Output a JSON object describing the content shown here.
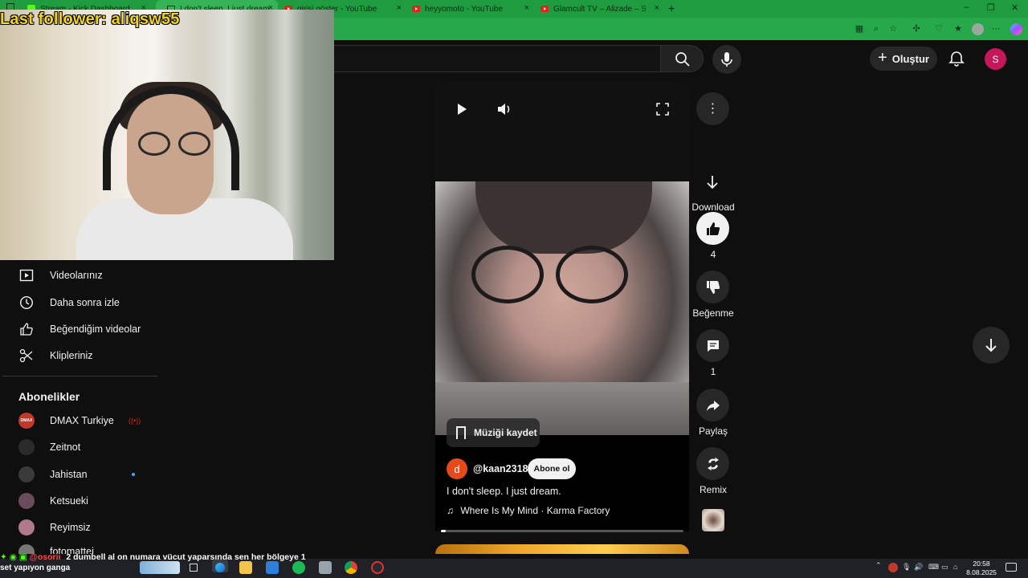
{
  "browser": {
    "tabs": [
      {
        "title": "Stream - Kick Dashboard"
      },
      {
        "title": "I don't sleep. I just dream."
      },
      {
        "title": "girişi göster - YouTube"
      },
      {
        "title": "heyyomoto - YouTube"
      },
      {
        "title": "Glamcult TV – Alizade – Stop Sm…"
      }
    ],
    "new_tab": "+",
    "close_glyph": "×",
    "window_controls": [
      "–",
      "❐",
      "✕"
    ]
  },
  "overlay": {
    "last_follower": "Last follower: aliqsw55"
  },
  "youtube": {
    "create_label": "Oluştur",
    "avatar_initial": "S"
  },
  "sidebar": {
    "items": [
      {
        "label": "Videolarınız",
        "icon": "play-box-icon"
      },
      {
        "label": "Daha sonra izle",
        "icon": "clock-icon"
      },
      {
        "label": "Beğendiğim videolar",
        "icon": "thumb-up-icon"
      },
      {
        "label": "Klipleriniz",
        "icon": "scissors-icon"
      }
    ],
    "subscriptions_title": "Abonelikler",
    "subscriptions": [
      {
        "name": "DMAX Turkiye",
        "status": "live",
        "color": "#c0392b",
        "avatar_text": "DMAX"
      },
      {
        "name": "Zeitnot",
        "status": "",
        "color": "#2b2b2b"
      },
      {
        "name": "Jahistan",
        "status": "new",
        "color": "#3a3a3a"
      },
      {
        "name": "Ketsueki",
        "status": "",
        "color": "#6a4c5c"
      },
      {
        "name": "Reyimsiz",
        "status": "",
        "color": "#b07a8c"
      },
      {
        "name": "fotomattei",
        "status": "",
        "color": "#777"
      }
    ]
  },
  "short": {
    "save_music": "Müziği kaydet",
    "channel_initial": "d",
    "channel": "@kaan2318",
    "subscribe": "Abone ol",
    "caption": "I don't sleep. I just dream.",
    "music": "Where Is My Mind · Karma Factory",
    "music_glyph": "♫",
    "progress_fraction": 0.02
  },
  "rail": {
    "download": "Download",
    "likes": "4",
    "dislike": "Beğenme",
    "comments": "1",
    "share": "Paylaş",
    "remix": "Remix"
  },
  "stream_chat": {
    "user": "@osorii",
    "message": "2 dumbell al on numara vücut yaparsında sen her bölgeye 1",
    "now_playing": "set yapıyon ganga"
  },
  "taskbar": {
    "time": "20:58",
    "date": "8.08.2025"
  },
  "colors": {
    "browser_accent": "#1f9c3f",
    "yt_bg": "#0f0f0f",
    "avatar_bg": "#c4185b",
    "live_red": "#e62117",
    "follower_yellow": "#f4d51c"
  }
}
